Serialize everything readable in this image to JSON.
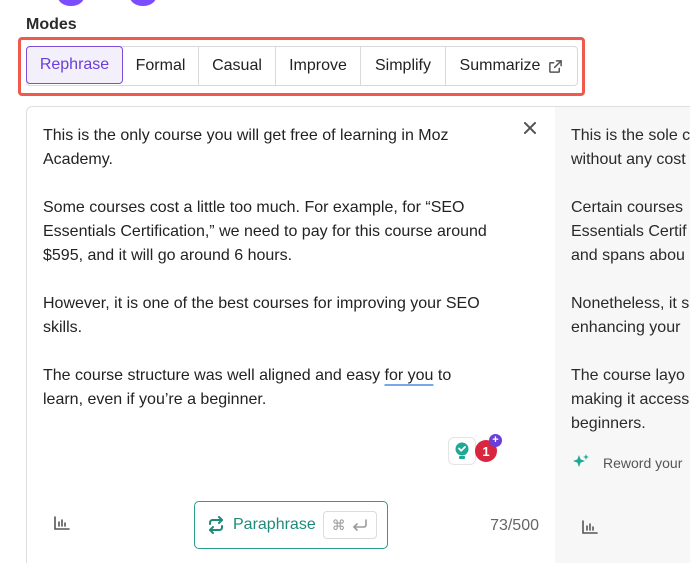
{
  "modes": {
    "label": "Modes",
    "tabs": [
      {
        "label": "Rephrase",
        "active": true
      },
      {
        "label": "Formal"
      },
      {
        "label": "Casual"
      },
      {
        "label": "Improve"
      },
      {
        "label": "Simplify"
      },
      {
        "label": "Summarize"
      }
    ]
  },
  "input": {
    "paragraphs": [
      "This is the only course you will get free of learning in Moz Academy.",
      "Some courses cost a little too much. For example, for “SEO Essentials Certification,” we need to pay for this course around $595, and it will go around 6 hours.",
      "However, it is one of the best courses for improving your SEO skills."
    ],
    "last_paragraph": {
      "before": "The course structure was well aligned and easy ",
      "underlined": "for you",
      "after": " to learn, even if you’re a beginner."
    },
    "error_count": "1",
    "char_count": "73/500"
  },
  "paraphrase_button": {
    "label": "Paraphrase",
    "shortcut": "⌘"
  },
  "output": {
    "lines": [
      [
        "This is the sole c",
        "without any cost"
      ],
      [
        "Certain courses",
        "Essentials Certif",
        "and spans abou"
      ],
      [
        "Nonetheless, it s",
        "enhancing your"
      ],
      [
        "The course layo",
        "making it access",
        "beginners."
      ]
    ],
    "reword_label": "Reword your"
  },
  "colors": {
    "accent": "#6a3fd8",
    "highlight": "#ef5a4c",
    "teal": "#1f8a7a",
    "error": "#d7263d"
  }
}
